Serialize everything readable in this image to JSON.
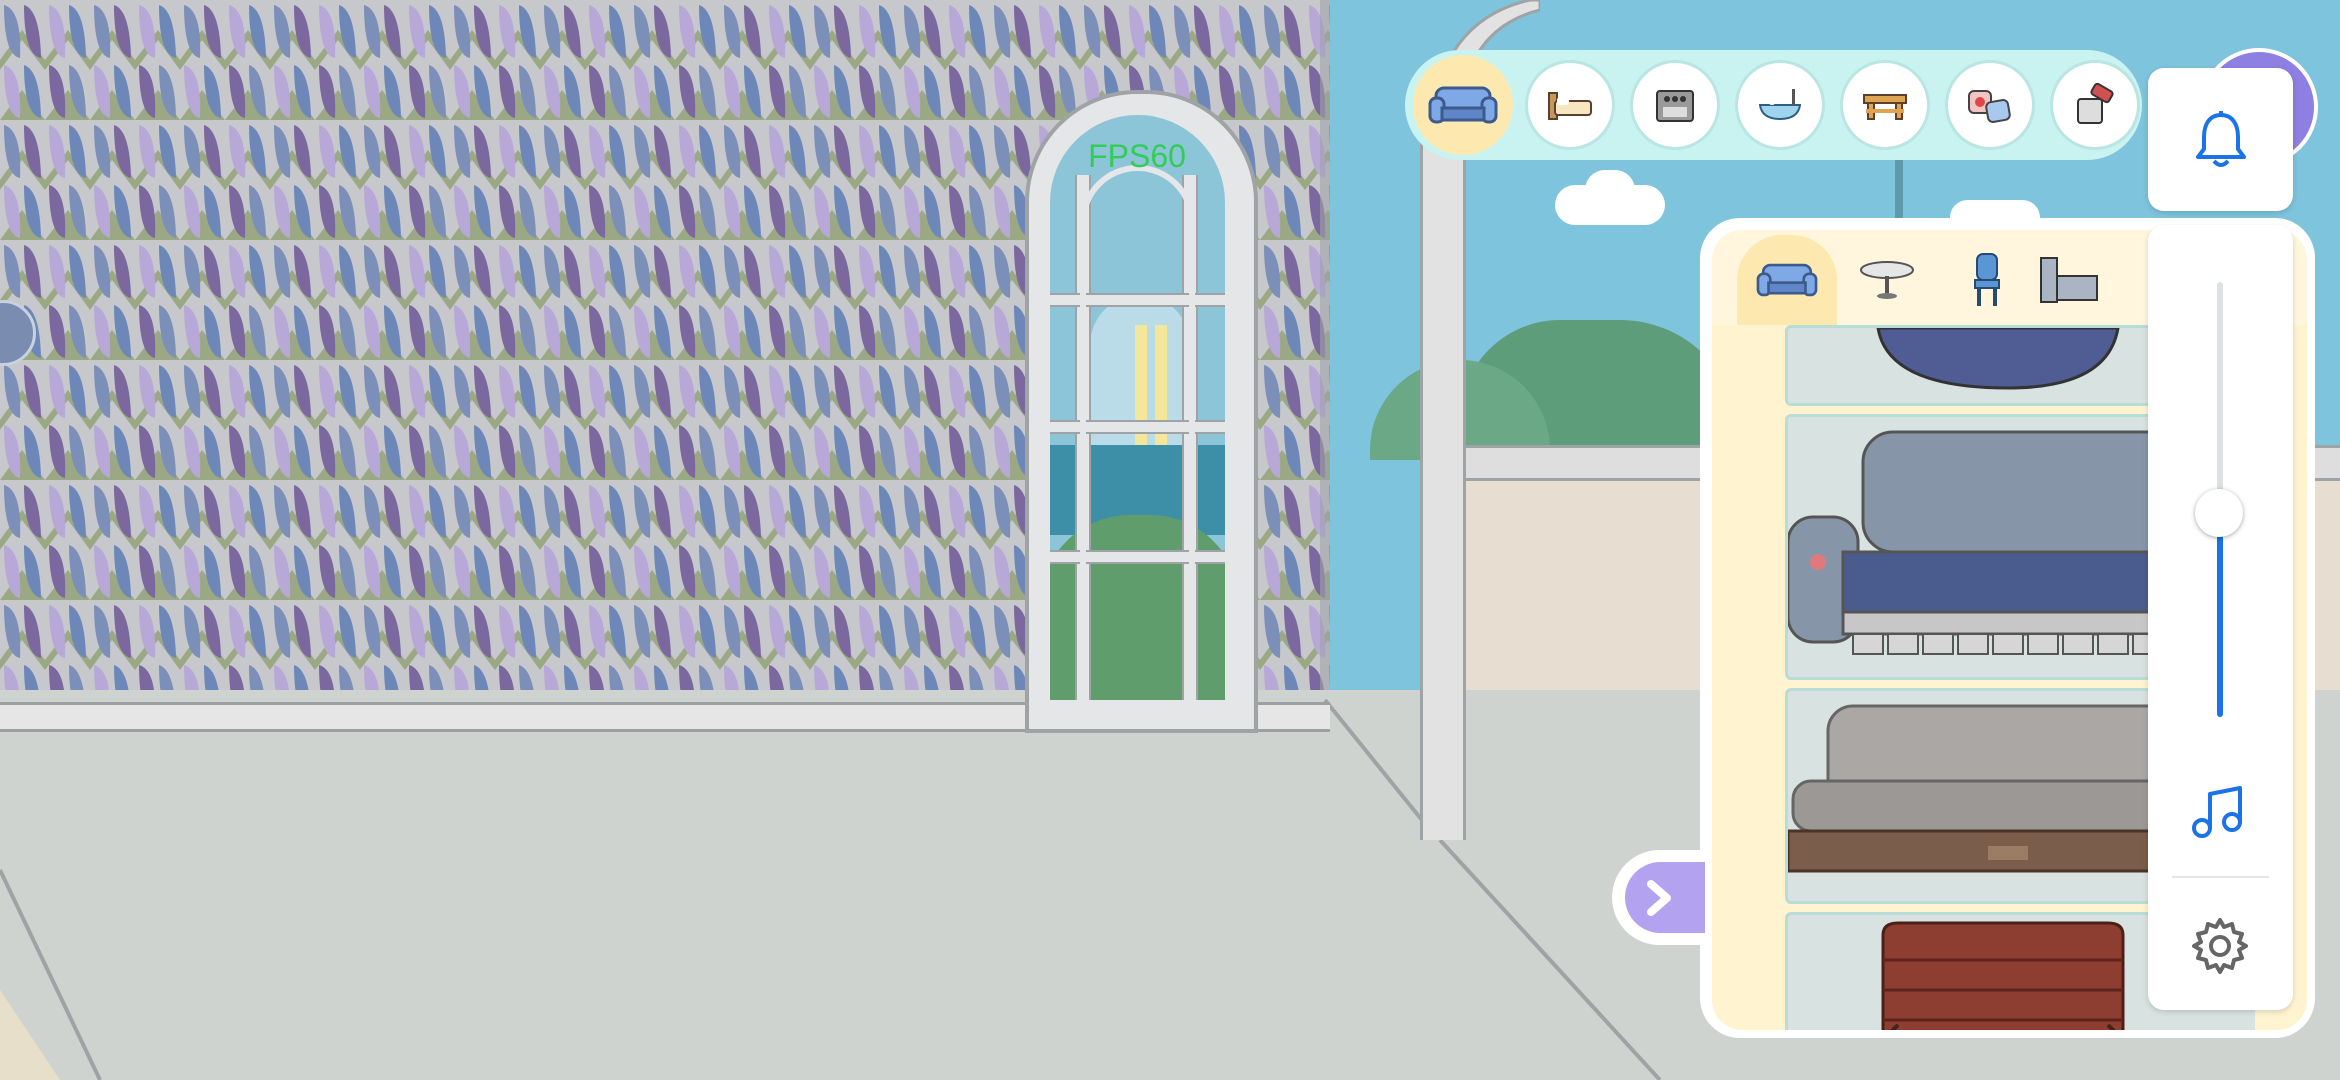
{
  "hud": {
    "fps_label": "FPS60"
  },
  "category_bar": {
    "items": [
      {
        "name": "sofa",
        "active": true
      },
      {
        "name": "bed",
        "active": false
      },
      {
        "name": "stove",
        "active": false
      },
      {
        "name": "bathtub",
        "active": false
      },
      {
        "name": "table",
        "active": false
      },
      {
        "name": "decorations",
        "active": false
      },
      {
        "name": "tools",
        "active": false
      }
    ]
  },
  "furniture_panel": {
    "tabs": [
      {
        "name": "sofa",
        "active": true
      },
      {
        "name": "round-table",
        "active": false
      },
      {
        "name": "chair",
        "active": false
      },
      {
        "name": "appliance",
        "active": false
      }
    ],
    "items": [
      {
        "name": "dark-blue-sofa"
      },
      {
        "name": "grey-blue-sofa"
      },
      {
        "name": "grey-wood-sofa"
      },
      {
        "name": "brown-slat-chair"
      }
    ]
  },
  "system_overlay": {
    "volume_level": 0.47,
    "icons": [
      "bell-icon",
      "music-note-icon",
      "gear-icon"
    ],
    "accent_color": "#1a73e8"
  },
  "colors": {
    "wallpaper_a": "#7b8fb8",
    "wallpaper_b": "#7a689e",
    "wallpaper_c": "#b7a8d8",
    "wallpaper_leaf": "#8b9a78",
    "panel_bg": "#fff3d0",
    "category_bar_bg": "#c9f3f0"
  }
}
